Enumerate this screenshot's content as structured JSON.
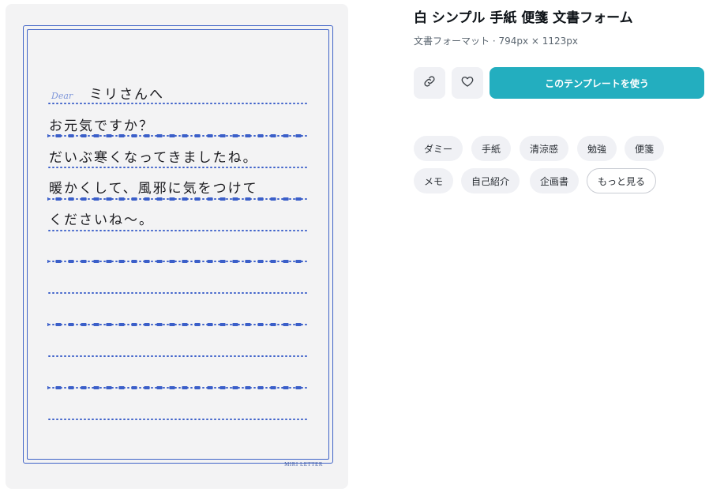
{
  "template": {
    "title": "白 シンプル 手紙 便箋 文書フォーム",
    "meta": "文書フォーマット · 794px × 1123px"
  },
  "actions": {
    "link_icon": "link-icon",
    "favorite_icon": "heart-icon",
    "use_label": "このテンプレートを使う"
  },
  "preview": {
    "dear": "Dear",
    "recipient": "ミリさんへ",
    "lines": [
      "お元気ですか？",
      "だいぶ寒くなってきましたね。",
      "暖かくして、風邪に気をつけて",
      "くださいね〜。"
    ],
    "brand": "MIRI LETTER"
  },
  "tags": [
    "ダミー",
    "手紙",
    "清涼感",
    "勉強",
    "便箋",
    "メモ",
    "自己紹介",
    "企画書"
  ],
  "more_label": "もっと見る",
  "colors": {
    "accent": "#23aebf",
    "letter_line": "#3b5fc9",
    "chip_bg": "#f0f1f5"
  }
}
